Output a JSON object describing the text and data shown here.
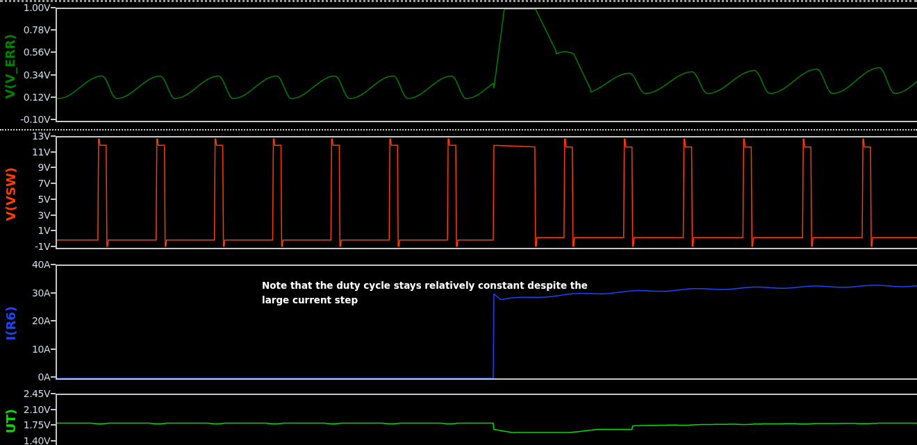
{
  "panels": [
    {
      "trace": "V(V_ERR)",
      "kind": "error",
      "color": "#008000",
      "yticks": [
        "1.00V",
        "0.78V",
        "0.56V",
        "0.34V",
        "0.12V",
        "-0.10V"
      ]
    },
    {
      "trace": "V(VSW)",
      "kind": "switch",
      "color": "#ff3c00",
      "yticks": [
        "13V",
        "11V",
        "9V",
        "7V",
        "5V",
        "3V",
        "1V",
        "-1V"
      ]
    },
    {
      "trace": "I(R6)",
      "kind": "current",
      "color": "#1a44ff",
      "yticks": [
        "40A",
        "30A",
        "20A",
        "10A",
        "0A"
      ],
      "note": "Note that the duty cycle stays relatively constant despite the large current step"
    },
    {
      "trace": "UT)",
      "kind": "output",
      "color": "#00e000",
      "yticks": [
        "2.45V",
        "2.10V",
        "1.75V",
        "1.40V"
      ]
    }
  ]
}
